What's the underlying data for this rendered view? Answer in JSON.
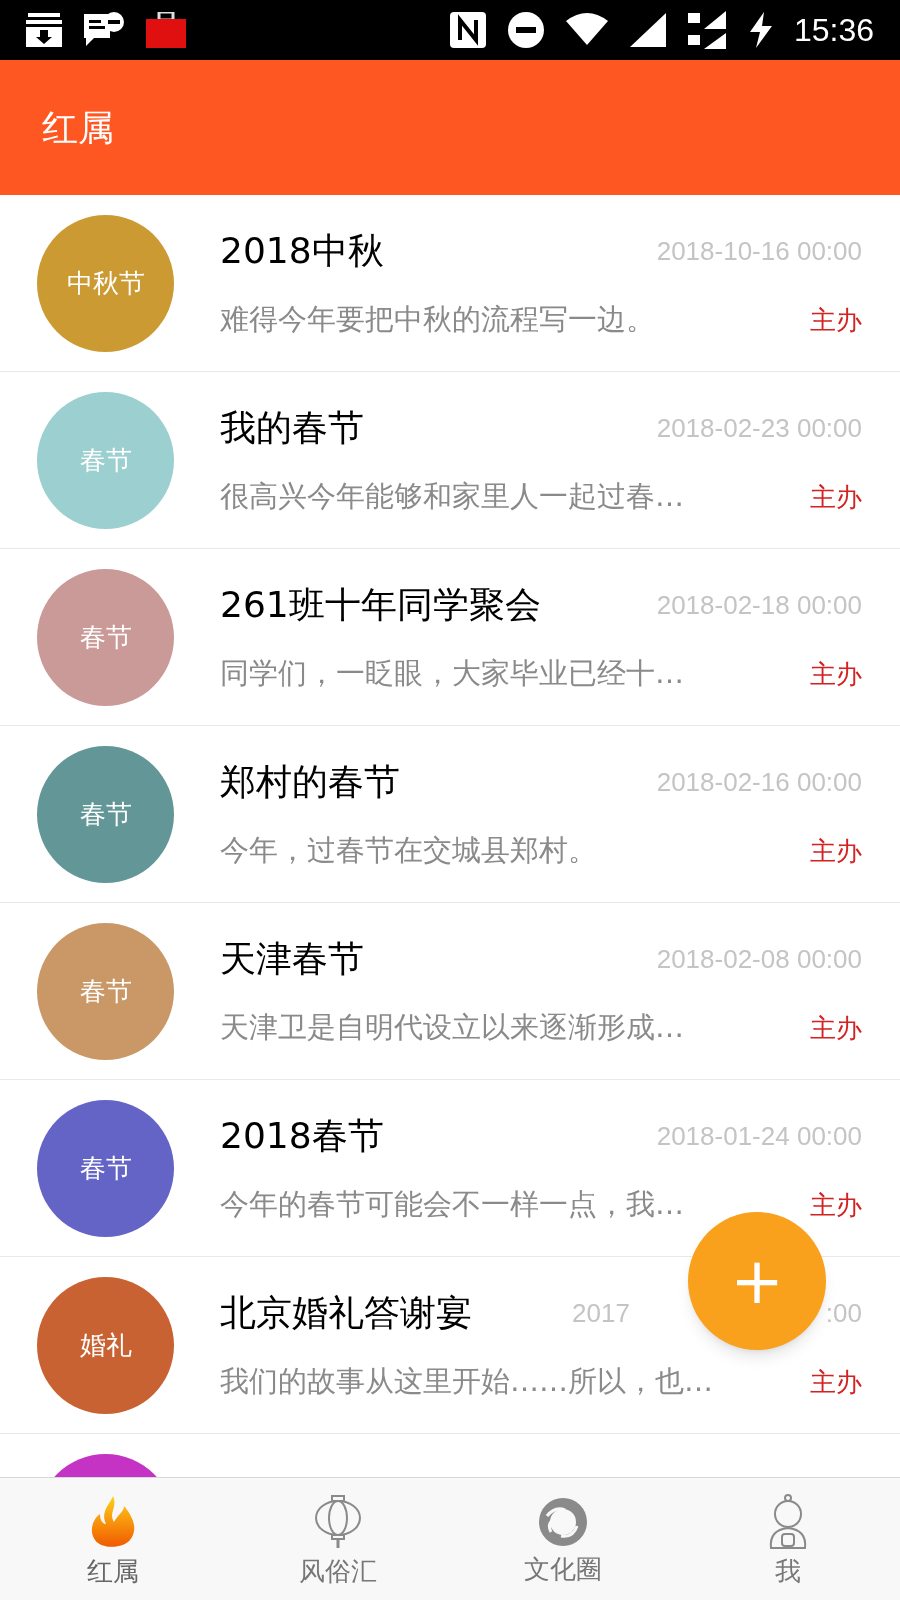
{
  "status_bar": {
    "time": "15:36"
  },
  "header": {
    "title": "红属"
  },
  "events": [
    {
      "kind": "full",
      "badge": "中秋节",
      "color": "#cc9a33",
      "title": "2018中秋",
      "date": [
        "2018-10-16 00:00"
      ],
      "summary": "难得今年要把中秋的流程写一边。",
      "role": "主办"
    },
    {
      "kind": "full",
      "badge": "春节",
      "color": "#9ccfcf",
      "title": "我的春节",
      "date": [
        "2018-02-23 00:00"
      ],
      "summary": "很高兴今年能够和家里人一起过春…",
      "role": "主办"
    },
    {
      "kind": "full",
      "badge": "春节",
      "color": "#c99a98",
      "title": "261班十年同学聚会",
      "date": [
        "2018-02-18 00:00"
      ],
      "summary": "同学们，一眨眼，大家毕业已经十…",
      "role": "主办"
    },
    {
      "kind": "full",
      "badge": "春节",
      "color": "#639797",
      "title": "郑村的春节",
      "date": [
        "2018-02-16 00:00"
      ],
      "summary": "今年，过春节在交城县郑村。",
      "role": "主办"
    },
    {
      "kind": "full",
      "badge": "春节",
      "color": "#c99866",
      "title": "天津春节",
      "date": [
        "2018-02-08 00:00"
      ],
      "summary": "天津卫是自明代设立以来逐渐形成…",
      "role": "主办"
    },
    {
      "kind": "full",
      "badge": "春节",
      "color": "#6464c6",
      "title": "2018春节",
      "date": [
        "2018-01-24 00:00"
      ],
      "summary": "今年的春节可能会不一样一点，我…",
      "role": "主办"
    },
    {
      "kind": "full",
      "badge": "婚礼",
      "color": "#c96232",
      "title": "北京婚礼答谢宴",
      "date": [
        "2017",
        ":00"
      ],
      "summary": "我们的故事从这里开始……所以，也…",
      "role": "主办"
    },
    {
      "kind": "partial",
      "color": "#c433c4"
    }
  ],
  "fab": {
    "label": "+"
  },
  "nav": [
    {
      "label": "红属",
      "kind": "flame",
      "selected": true
    },
    {
      "label": "风俗汇",
      "kind": "lantern",
      "selected": false
    },
    {
      "label": "文化圈",
      "kind": "swirl",
      "selected": false
    },
    {
      "label": "我",
      "kind": "person",
      "selected": false
    }
  ]
}
